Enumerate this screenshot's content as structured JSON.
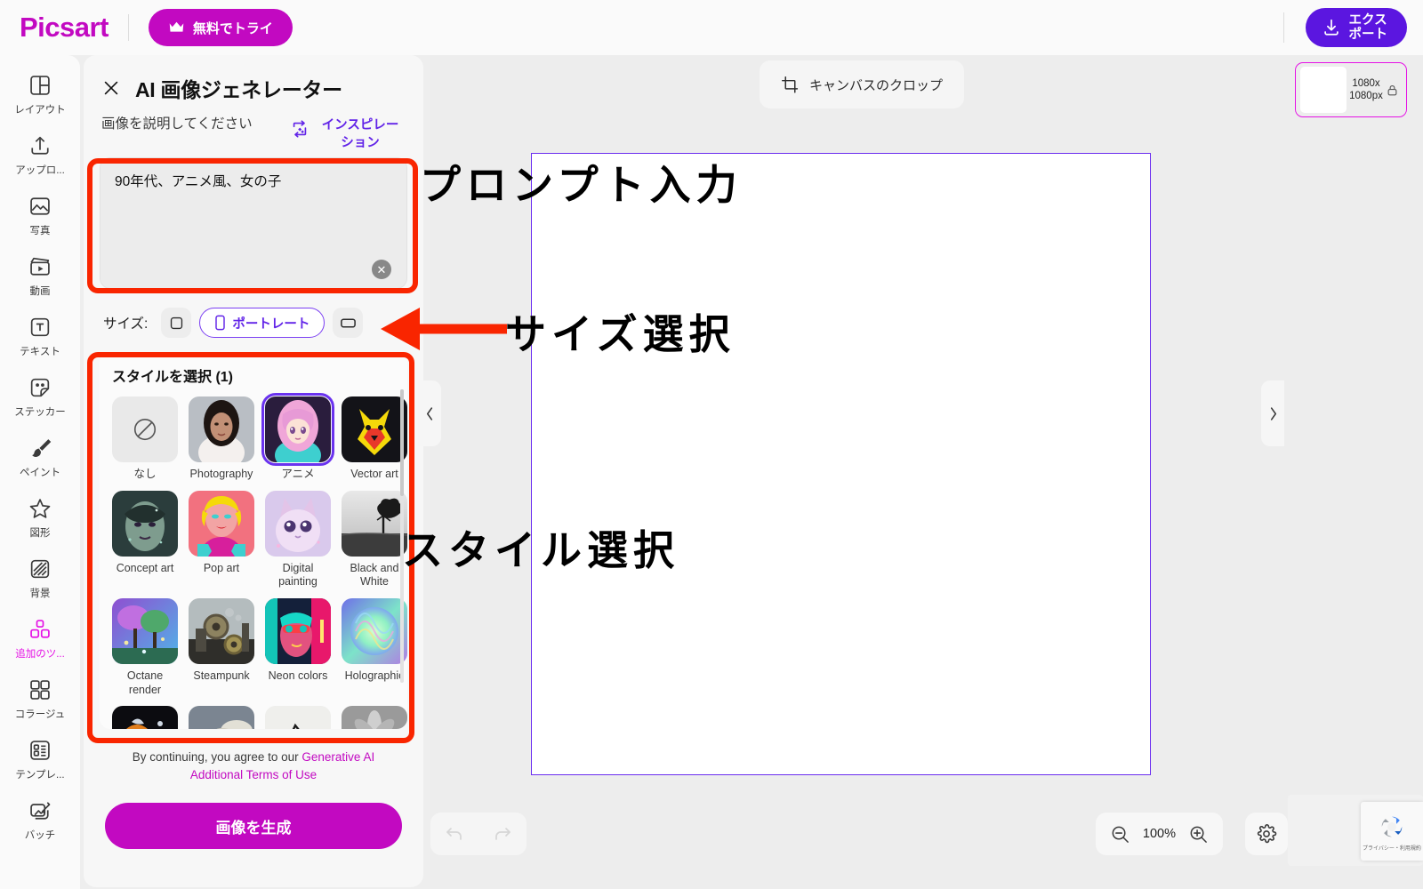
{
  "topbar": {
    "logo": "Picsart",
    "try_button": "無料でトライ",
    "export_line1": "エクス",
    "export_line2": "ポート",
    "brand_color": "#c209c1",
    "export_color": "#5b16e0"
  },
  "sidebar": {
    "items": [
      {
        "label": "レイアウト",
        "icon": "layout-icon",
        "active": false
      },
      {
        "label": "アップロ...",
        "icon": "upload-icon",
        "active": false
      },
      {
        "label": "写真",
        "icon": "photo-icon",
        "active": false
      },
      {
        "label": "動画",
        "icon": "video-icon",
        "active": false
      },
      {
        "label": "テキスト",
        "icon": "text-icon",
        "active": false
      },
      {
        "label": "ステッカー",
        "icon": "sticker-icon",
        "active": false
      },
      {
        "label": "ペイント",
        "icon": "paint-icon",
        "active": false
      },
      {
        "label": "図形",
        "icon": "shape-icon",
        "active": false
      },
      {
        "label": "背景",
        "icon": "background-icon",
        "active": false
      },
      {
        "label": "追加のツ...",
        "icon": "more-tools-icon",
        "active": true
      },
      {
        "label": "コラージュ",
        "icon": "collage-icon",
        "active": false
      },
      {
        "label": "テンプレ...",
        "icon": "template-icon",
        "active": false
      },
      {
        "label": "バッチ",
        "icon": "batch-icon",
        "active": false
      }
    ]
  },
  "panel": {
    "title": "AI 画像ジェネレーター",
    "close_icon": "close-icon",
    "prompt_label": "画像を説明してください",
    "inspiration_label": "インスピレーション",
    "inspiration_icon": "magic-wand-icon",
    "prompt_value": "90年代、アニメ風、女の子",
    "prompt_placeholder": "画像を説明してください",
    "clear_icon": "clear-icon",
    "size": {
      "label": "サイズ:",
      "options": [
        {
          "name": "square",
          "icon": "square-icon",
          "selected": false,
          "label": ""
        },
        {
          "name": "portrait",
          "icon": "portrait-icon",
          "selected": true,
          "label": "ポートレート"
        },
        {
          "name": "landscape",
          "icon": "landscape-icon",
          "selected": false,
          "label": ""
        }
      ]
    },
    "styles": {
      "title": "スタイルを選択 (1)",
      "items": [
        {
          "name": "なし",
          "selected": false,
          "kind": "none"
        },
        {
          "name": "Photography",
          "selected": false,
          "kind": "photography"
        },
        {
          "name": "アニメ",
          "selected": true,
          "kind": "anime"
        },
        {
          "name": "Vector art",
          "selected": false,
          "kind": "vector"
        },
        {
          "name": "Concept art",
          "selected": false,
          "kind": "concept"
        },
        {
          "name": "Pop art",
          "selected": false,
          "kind": "popart"
        },
        {
          "name": "Digital painting",
          "selected": false,
          "kind": "digital"
        },
        {
          "name": "Black and White",
          "selected": false,
          "kind": "bw"
        },
        {
          "name": "Octane render",
          "selected": false,
          "kind": "octane"
        },
        {
          "name": "Steampunk",
          "selected": false,
          "kind": "steampunk"
        },
        {
          "name": "Neon colors",
          "selected": false,
          "kind": "neon"
        },
        {
          "name": "Holographic",
          "selected": false,
          "kind": "holo"
        },
        {
          "name": "",
          "selected": false,
          "kind": "fire"
        },
        {
          "name": "",
          "selected": false,
          "kind": "clouds"
        },
        {
          "name": "",
          "selected": false,
          "kind": "sketch"
        },
        {
          "name": "",
          "selected": false,
          "kind": "flower"
        }
      ]
    },
    "terms_prefix": "By continuing, you agree to our ",
    "terms_link": "Generative AI Additional Terms of Use",
    "generate_button": "画像を生成"
  },
  "canvas": {
    "crop_button": "キャンバスのクロップ",
    "crop_icon": "crop-icon",
    "nav_prev_icon": "chevron-left-icon",
    "nav_next_icon": "chevron-right-icon"
  },
  "layer": {
    "dimensions_line1": "1080x",
    "dimensions_line2": "1080px",
    "lock_icon": "lock-icon"
  },
  "bottombar": {
    "undo_icon": "undo-icon",
    "redo_icon": "redo-icon",
    "zoom_out_icon": "zoom-out-icon",
    "zoom_in_icon": "zoom-in-icon",
    "zoom_value": "100%",
    "settings_icon": "gear-icon",
    "recaptcha_text": "プライバシー・利用規約"
  },
  "annotations": [
    {
      "id": "prompt",
      "text": "プロンプト入力"
    },
    {
      "id": "size",
      "text": "サイズ選択"
    },
    {
      "id": "style",
      "text": "スタイル選択"
    }
  ]
}
